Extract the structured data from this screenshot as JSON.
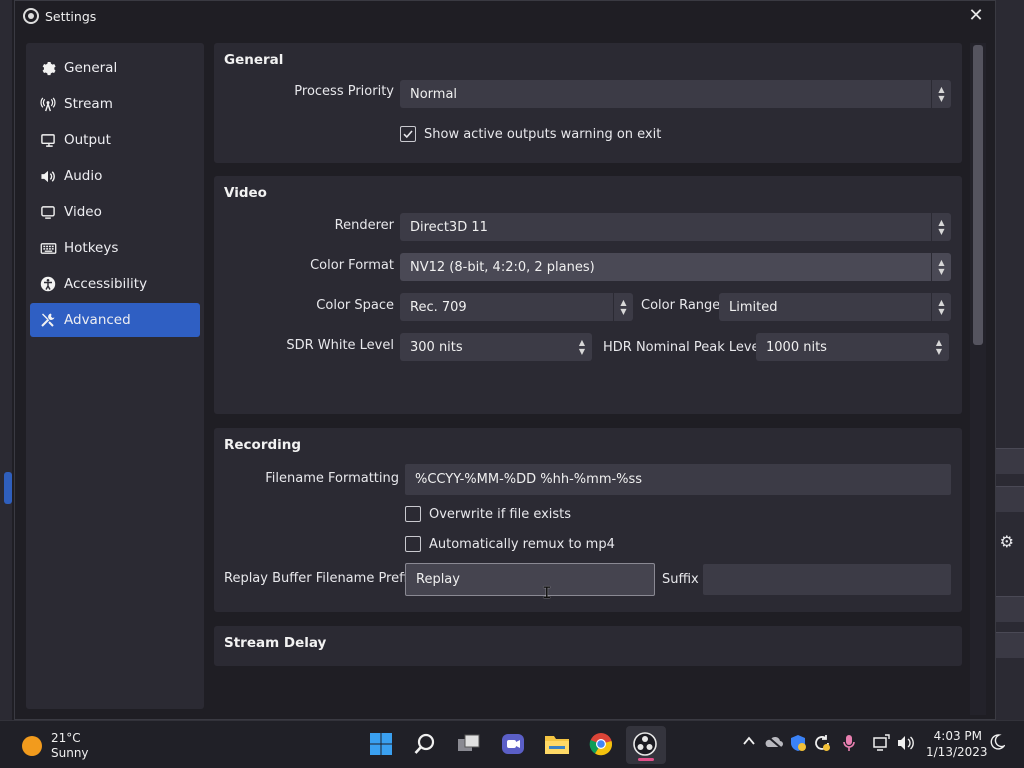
{
  "window": {
    "title": "Settings",
    "close_glyph": "✕"
  },
  "sidebar": {
    "items": [
      {
        "label": "General",
        "icon": "gear-icon",
        "active": false
      },
      {
        "label": "Stream",
        "icon": "antenna-icon",
        "active": false
      },
      {
        "label": "Output",
        "icon": "output-icon",
        "active": false
      },
      {
        "label": "Audio",
        "icon": "speaker-icon",
        "active": false
      },
      {
        "label": "Video",
        "icon": "monitor-icon",
        "active": false
      },
      {
        "label": "Hotkeys",
        "icon": "keyboard-icon",
        "active": false
      },
      {
        "label": "Accessibility",
        "icon": "accessibility-icon",
        "active": false
      },
      {
        "label": "Advanced",
        "icon": "tools-icon",
        "active": true
      }
    ]
  },
  "general": {
    "title": "General",
    "process_priority_label": "Process Priority",
    "process_priority_value": "Normal",
    "show_warning_label": "Show active outputs warning on exit",
    "show_warning_checked": true
  },
  "video": {
    "title": "Video",
    "renderer_label": "Renderer",
    "renderer_value": "Direct3D 11",
    "color_format_label": "Color Format",
    "color_format_value": "NV12 (8-bit, 4:2:0, 2 planes)",
    "color_space_label": "Color Space",
    "color_space_value": "Rec. 709",
    "color_range_label": "Color Range",
    "color_range_value": "Limited",
    "sdr_label": "SDR White Level",
    "sdr_value": "300 nits",
    "hdr_label": "HDR Nominal Peak Level",
    "hdr_value": "1000 nits"
  },
  "recording": {
    "title": "Recording",
    "filename_label": "Filename Formatting",
    "filename_value": "%CCYY-%MM-%DD %hh-%mm-%ss",
    "overwrite_label": "Overwrite if file exists",
    "overwrite_checked": false,
    "remux_label": "Automatically remux to mp4",
    "remux_checked": false,
    "replay_prefix_label": "Replay Buffer Filename Prefix",
    "replay_prefix_value": "Replay",
    "suffix_label": "Suffix",
    "suffix_value": ""
  },
  "stream_delay": {
    "title": "Stream Delay"
  },
  "taskbar": {
    "weather_temp": "21°C",
    "weather_desc": "Sunny",
    "time": "4:03 PM",
    "date": "1/13/2023"
  },
  "colors": {
    "accent": "#2f5fc3",
    "panel": "#2b2a33",
    "background": "#1f1e24",
    "field": "#3c3b46"
  }
}
